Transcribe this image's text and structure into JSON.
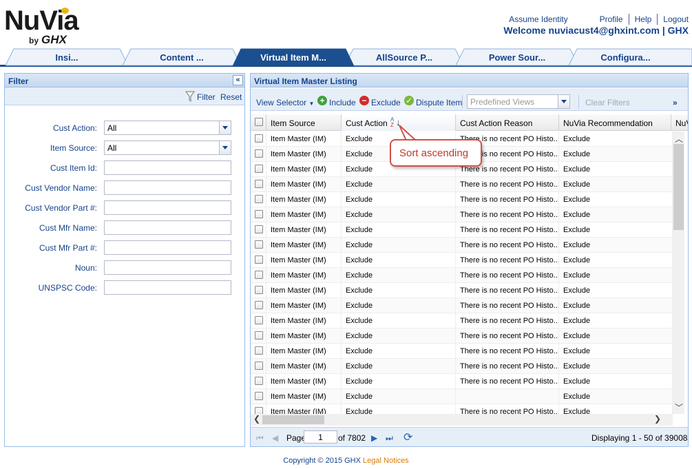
{
  "brand": {
    "name": "NuVia",
    "by": "by",
    "company": "GHX",
    "accent": "#e7b416"
  },
  "header": {
    "assume_identity": "Assume Identity",
    "profile": "Profile",
    "help": "Help",
    "logout": "Logout",
    "welcome": "Welcome nuviacust4@ghxint.com | GHX"
  },
  "tabs": [
    {
      "label": "Insi...",
      "active": false
    },
    {
      "label": "Content ...",
      "active": false
    },
    {
      "label": "Virtual Item M...",
      "active": true
    },
    {
      "label": "AllSource P...",
      "active": false
    },
    {
      "label": "Power Sour...",
      "active": false
    },
    {
      "label": "Configura...",
      "active": false
    }
  ],
  "filter": {
    "title": "Filter",
    "filter_btn": "Filter",
    "reset_btn": "Reset",
    "fields": [
      {
        "label": "Cust Action:",
        "type": "select",
        "value": "All"
      },
      {
        "label": "Item Source:",
        "type": "select",
        "value": "All"
      },
      {
        "label": "Cust Item Id:",
        "type": "text",
        "value": ""
      },
      {
        "label": "Cust Vendor Name:",
        "type": "text",
        "value": ""
      },
      {
        "label": "Cust Vendor Part #:",
        "type": "text",
        "value": ""
      },
      {
        "label": "Cust Mfr Name:",
        "type": "text",
        "value": ""
      },
      {
        "label": "Cust Mfr Part #:",
        "type": "text",
        "value": ""
      },
      {
        "label": "Noun:",
        "type": "text",
        "value": ""
      },
      {
        "label": "UNSPSC Code:",
        "type": "text",
        "value": ""
      }
    ]
  },
  "listing": {
    "title": "Virtual Item Master Listing",
    "toolbar": {
      "view_selector": "View Selector",
      "include": "Include",
      "exclude": "Exclude",
      "dispute": "Dispute Item",
      "predefined_placeholder": "Predefined Views",
      "clear_filters": "Clear Filters",
      "more": "»"
    },
    "columns": [
      "Item Source",
      "Cust Action",
      "Cust Action Reason",
      "NuVia Recommendation",
      "NuV"
    ],
    "sort_tooltip": "Sort ascending",
    "rows": [
      {
        "source": "Item Master (IM)",
        "action": "Exclude",
        "reason": "There is no recent PO Histo...",
        "rec": "Exclude"
      },
      {
        "source": "Item Master (IM)",
        "action": "Exclude",
        "reason": "There is no recent PO Histo...",
        "rec": "Exclude"
      },
      {
        "source": "Item Master (IM)",
        "action": "Exclude",
        "reason": "There is no recent PO Histo...",
        "rec": "Exclude"
      },
      {
        "source": "Item Master (IM)",
        "action": "Exclude",
        "reason": "There is no recent PO Histo...",
        "rec": "Exclude"
      },
      {
        "source": "Item Master (IM)",
        "action": "Exclude",
        "reason": "There is no recent PO Histo...",
        "rec": "Exclude"
      },
      {
        "source": "Item Master (IM)",
        "action": "Exclude",
        "reason": "There is no recent PO Histo...",
        "rec": "Exclude"
      },
      {
        "source": "Item Master (IM)",
        "action": "Exclude",
        "reason": "There is no recent PO Histo...",
        "rec": "Exclude"
      },
      {
        "source": "Item Master (IM)",
        "action": "Exclude",
        "reason": "There is no recent PO Histo...",
        "rec": "Exclude"
      },
      {
        "source": "Item Master (IM)",
        "action": "Exclude",
        "reason": "There is no recent PO Histo...",
        "rec": "Exclude"
      },
      {
        "source": "Item Master (IM)",
        "action": "Exclude",
        "reason": "There is no recent PO Histo...",
        "rec": "Exclude"
      },
      {
        "source": "Item Master (IM)",
        "action": "Exclude",
        "reason": "There is no recent PO Histo...",
        "rec": "Exclude"
      },
      {
        "source": "Item Master (IM)",
        "action": "Exclude",
        "reason": "There is no recent PO Histo...",
        "rec": "Exclude"
      },
      {
        "source": "Item Master (IM)",
        "action": "Exclude",
        "reason": "There is no recent PO Histo...",
        "rec": "Exclude"
      },
      {
        "source": "Item Master (IM)",
        "action": "Exclude",
        "reason": "There is no recent PO Histo...",
        "rec": "Exclude"
      },
      {
        "source": "Item Master (IM)",
        "action": "Exclude",
        "reason": "There is no recent PO Histo...",
        "rec": "Exclude"
      },
      {
        "source": "Item Master (IM)",
        "action": "Exclude",
        "reason": "There is no recent PO Histo...",
        "rec": "Exclude"
      },
      {
        "source": "Item Master (IM)",
        "action": "Exclude",
        "reason": "There is no recent PO Histo...",
        "rec": "Exclude"
      },
      {
        "source": "Item Master (IM)",
        "action": "Exclude",
        "reason": "",
        "rec": "Exclude"
      },
      {
        "source": "Item Master (IM)",
        "action": "Exclude",
        "reason": "There is no recent PO Histo...",
        "rec": "Exclude"
      }
    ],
    "pager": {
      "page_label": "Page",
      "page_value": "1",
      "of_label": "of 7802",
      "displaying": "Displaying 1 - 50 of 390083"
    }
  },
  "footer": {
    "copyright": "Copyright © 2015 GHX",
    "legal": "Legal Notices"
  }
}
